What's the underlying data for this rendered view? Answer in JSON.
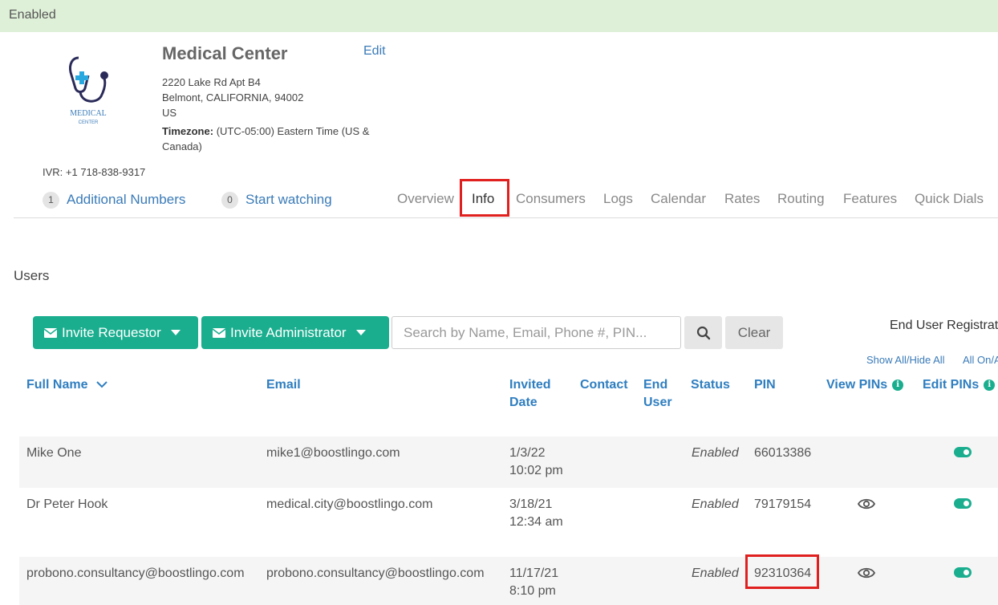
{
  "banner": {
    "text": "Enabled"
  },
  "org": {
    "name": "Medical Center",
    "edit_label": "Edit",
    "address_line1": "2220 Lake Rd Apt B4",
    "address_line2": "Belmont, CALIFORNIA, 94002",
    "address_line3": "US",
    "timezone_label": "Timezone:",
    "timezone_value": "(UTC-05:00) Eastern Time (US & Canada)",
    "ivr": "IVR: +1 718-838-9317",
    "logo_text_top": "MEDICAL",
    "logo_text_bottom": "CENTER"
  },
  "sublinks": [
    {
      "count": "1",
      "label": "Additional Numbers"
    },
    {
      "count": "0",
      "label": "Start watching"
    }
  ],
  "tabs": [
    {
      "label": "Overview"
    },
    {
      "label": "Info",
      "active": true
    },
    {
      "label": "Consumers"
    },
    {
      "label": "Logs"
    },
    {
      "label": "Calendar"
    },
    {
      "label": "Rates"
    },
    {
      "label": "Routing"
    },
    {
      "label": "Features"
    },
    {
      "label": "Quick Dials"
    }
  ],
  "users": {
    "heading": "Users",
    "invite_requestor": "Invite Requestor",
    "invite_administrator": "Invite Administrator",
    "search_placeholder": "Search by Name, Email, Phone #, PIN...",
    "clear_label": "Clear",
    "registration_title": "End User Registration",
    "show_all_hide_all": "Show All/Hide All",
    "all_on_all_off": "All On/All Off"
  },
  "table": {
    "headers": {
      "full_name": "Full Name",
      "email": "Email",
      "invited_line1": "Invited",
      "invited_line2": "Date",
      "contact": "Contact",
      "end_user_line1": "End",
      "end_user_line2": "User",
      "status": "Status",
      "pin": "PIN",
      "view_pins": "View PINs",
      "edit_pins": "Edit PINs"
    },
    "rows": [
      {
        "name": "Mike One",
        "email": "mike1@boostlingo.com",
        "date": "1/3/22",
        "time": "10:02 pm",
        "status": "Enabled",
        "pin": "66013386",
        "view_pin": false,
        "edit_pin": true
      },
      {
        "name": "Dr Peter Hook",
        "email": "medical.city@boostlingo.com",
        "date": "3/18/21",
        "time": "12:34 am",
        "status": "Enabled",
        "pin": "79179154",
        "view_pin": true,
        "edit_pin": true
      },
      {
        "name": "probono.consultancy@boostlingo.com",
        "email": "probono.consultancy@boostlingo.com",
        "date": "11/17/21",
        "time": "8:10 pm",
        "status": "Enabled",
        "pin": "92310364",
        "view_pin": true,
        "edit_pin": true
      }
    ]
  },
  "colors": {
    "banner_bg": "#dff0d8",
    "accent_green": "#1aae8f",
    "link_blue": "#3a7bb8",
    "highlight_red": "#e0201e"
  }
}
